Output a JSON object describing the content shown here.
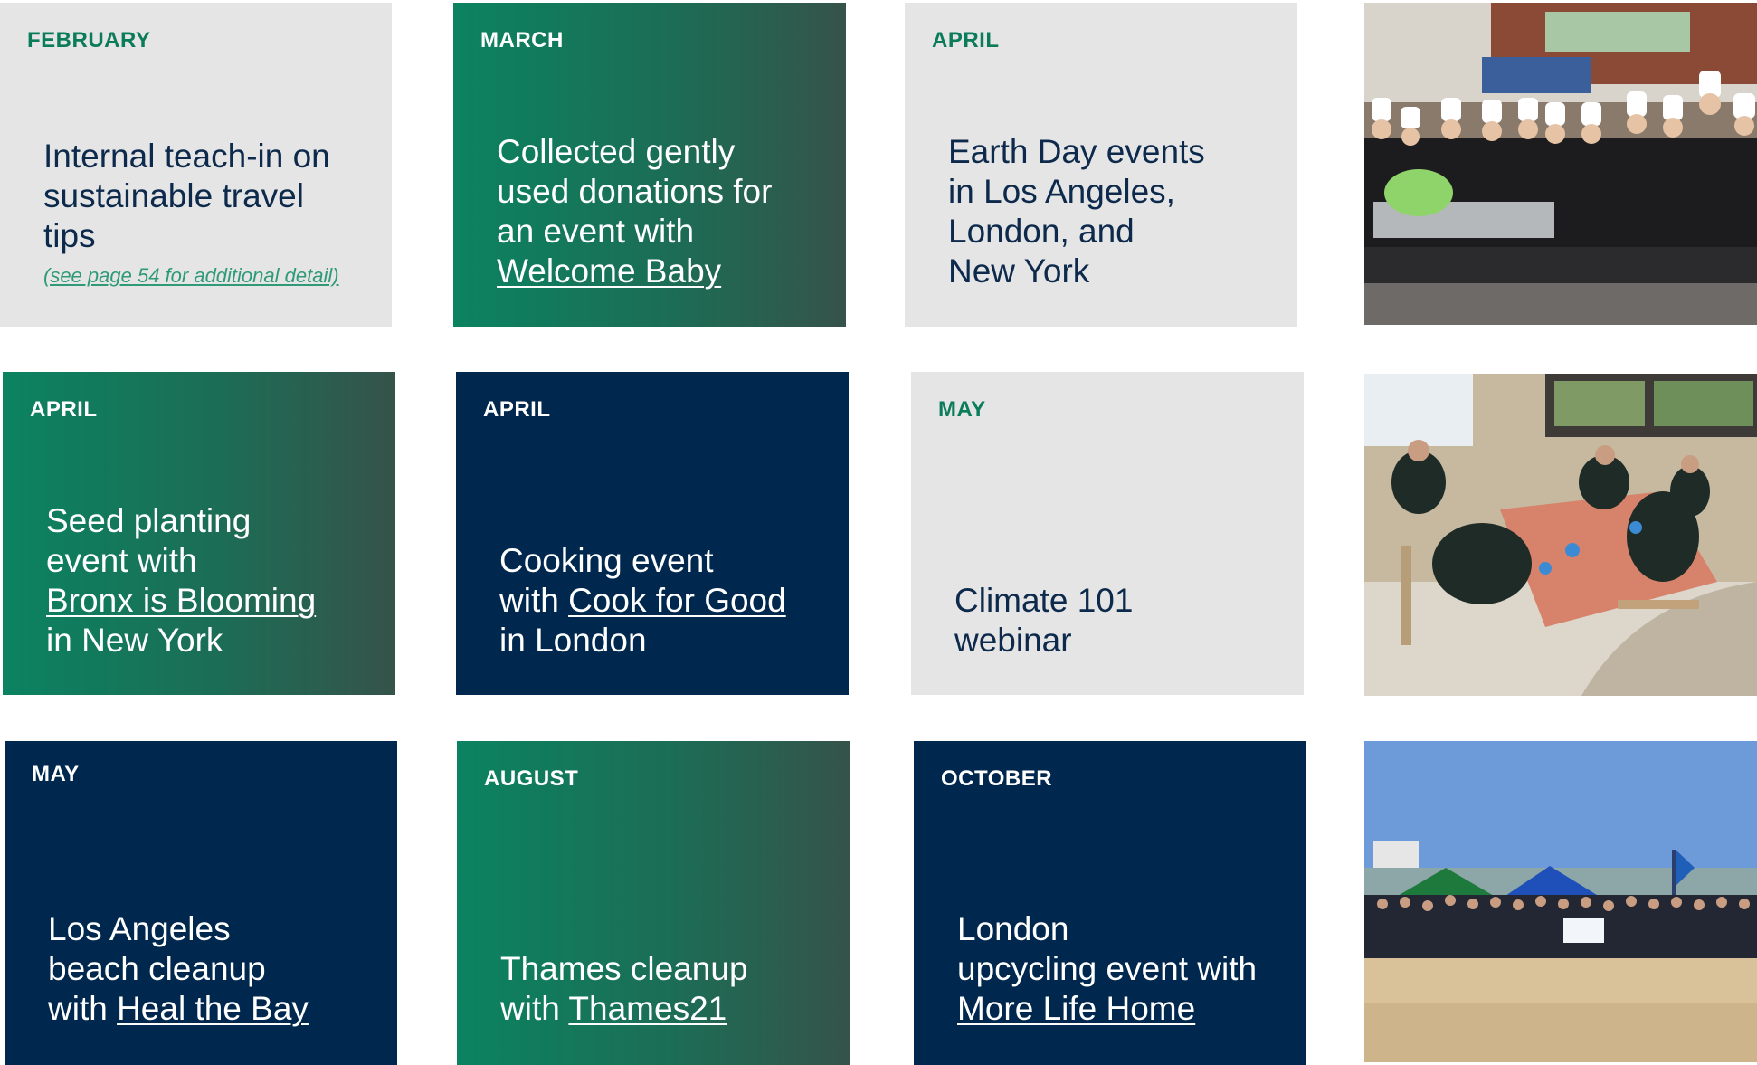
{
  "tiles": [
    {
      "month": "FEBRUARY",
      "lines": [
        "Internal teach-in on",
        "sustainable travel",
        "tips"
      ],
      "note": "(see page 54 for additional detail)"
    },
    {
      "month": "MARCH",
      "lines": [
        "Collected gently",
        "used donations for",
        "an event with"
      ],
      "link": "Welcome Baby"
    },
    {
      "month": "APRIL",
      "lines": [
        "Earth Day events",
        "in Los Angeles,",
        "London, and",
        "New York"
      ]
    },
    {
      "month": "APRIL",
      "lines": [
        "Seed planting",
        "event with"
      ],
      "link": "Bronx is Blooming",
      "after": "in New York"
    },
    {
      "month": "APRIL",
      "lines": [
        "Cooking event"
      ],
      "link_prefix": "with ",
      "link": "Cook for Good",
      "after": "in London"
    },
    {
      "month": "MAY",
      "lines": [
        "Climate 101",
        "webinar"
      ]
    },
    {
      "month": "MAY",
      "lines": [
        "Los Angeles",
        "beach cleanup"
      ],
      "link_prefix": "with ",
      "link": "Heal the Bay"
    },
    {
      "month": "AUGUST",
      "lines": [
        "Thames cleanup"
      ],
      "link_prefix": "with ",
      "link": "Thames21"
    },
    {
      "month": "OCTOBER",
      "lines": [
        "London",
        "upcycling event with"
      ],
      "link": "More Life Home"
    }
  ],
  "photos": [
    {
      "subject": "cooking-event-group-photo"
    },
    {
      "subject": "seed-planting-table-photo"
    },
    {
      "subject": "beach-cleanup-group-photo"
    }
  ],
  "colors": {
    "gray_tile": "#e5e5e5",
    "green_gradient_start": "#0b8361",
    "green_gradient_end": "#35534a",
    "navy_tile": "#00284e",
    "gray_month_text": "#0b7c5a",
    "gray_body_text": "#0d2a4c"
  }
}
